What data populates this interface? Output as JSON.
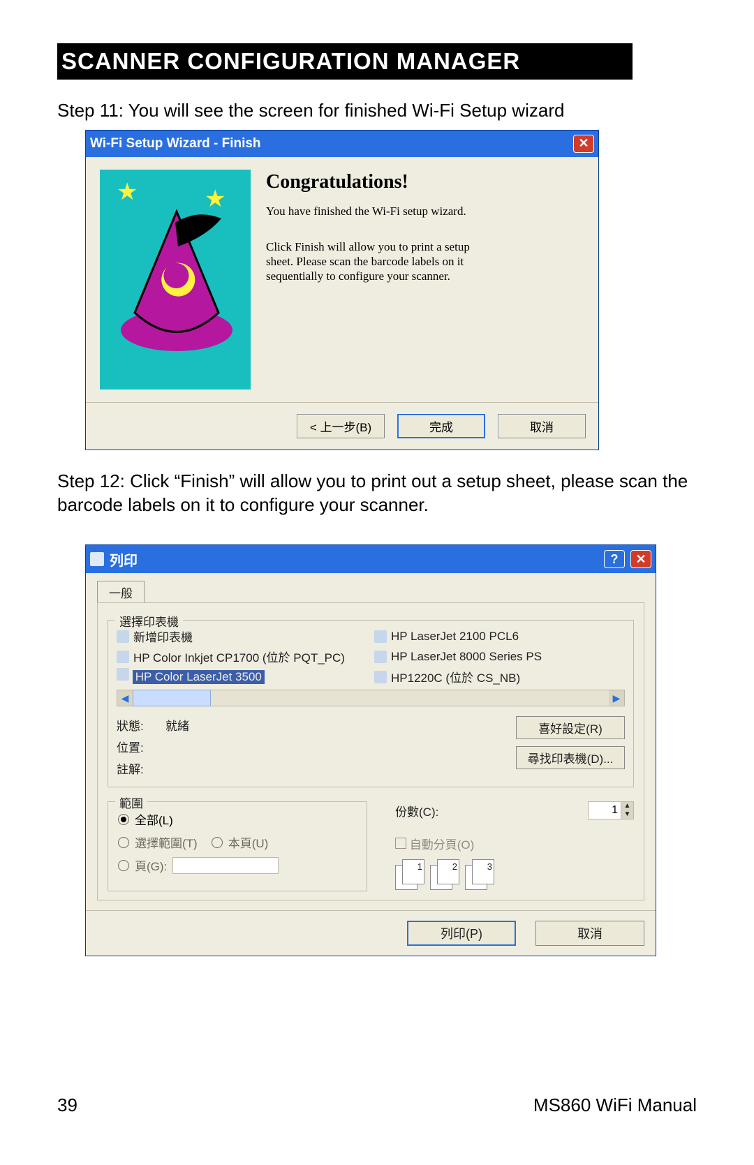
{
  "header": "SCANNER CONFIGURATION MANAGER",
  "step11": "Step 11: You will see the screen for finished Wi-Fi Setup wizard",
  "step12_line": "Step 12: Click “Finish” will allow you to print out a setup sheet, please scan the barcode labels on it to configure your scanner.",
  "wizard": {
    "title": "Wi-Fi Setup Wizard - Finish",
    "heading": "Congratulations!",
    "sub": "You have finished the Wi-Fi setup wizard.",
    "desc": "Click Finish will allow you to print a setup sheet. Please scan the barcode labels on it sequentially to configure your scanner.",
    "back_btn": "< 上一步(B)",
    "finish_btn": "完成",
    "cancel_btn": "取消"
  },
  "print": {
    "title": "列印",
    "tab_general": "一般",
    "group_select_printer": "選擇印表機",
    "printers": [
      {
        "name": "新增印表機"
      },
      {
        "name": "HP Color Inkjet CP1700 (位於 PQT_PC)"
      },
      {
        "name": "HP Color LaserJet 3500",
        "selected": true
      },
      {
        "name": "HP LaserJet 2100 PCL6"
      },
      {
        "name": "HP LaserJet 8000 Series PS"
      },
      {
        "name": "HP1220C (位於 CS_NB)"
      }
    ],
    "lbl_status": "狀態:",
    "status_value": "就緒",
    "lbl_location": "位置:",
    "lbl_comment": "註解:",
    "btn_prefs": "喜好設定(R)",
    "btn_find": "尋找印表機(D)...",
    "group_range": "範圍",
    "radio_all": "全部(L)",
    "radio_selection": "選擇範圍(T)",
    "radio_current": "本頁(U)",
    "radio_pages": "頁(G):",
    "lbl_copies": "份數(C):",
    "copies_value": "1",
    "chk_collate": "自動分頁(O)",
    "collate_icons": [
      "1",
      "2",
      "3"
    ],
    "btn_print": "列印(P)",
    "btn_cancel": "取消"
  },
  "footer": {
    "page_no": "39",
    "manual": "MS860 WiFi Manual"
  }
}
